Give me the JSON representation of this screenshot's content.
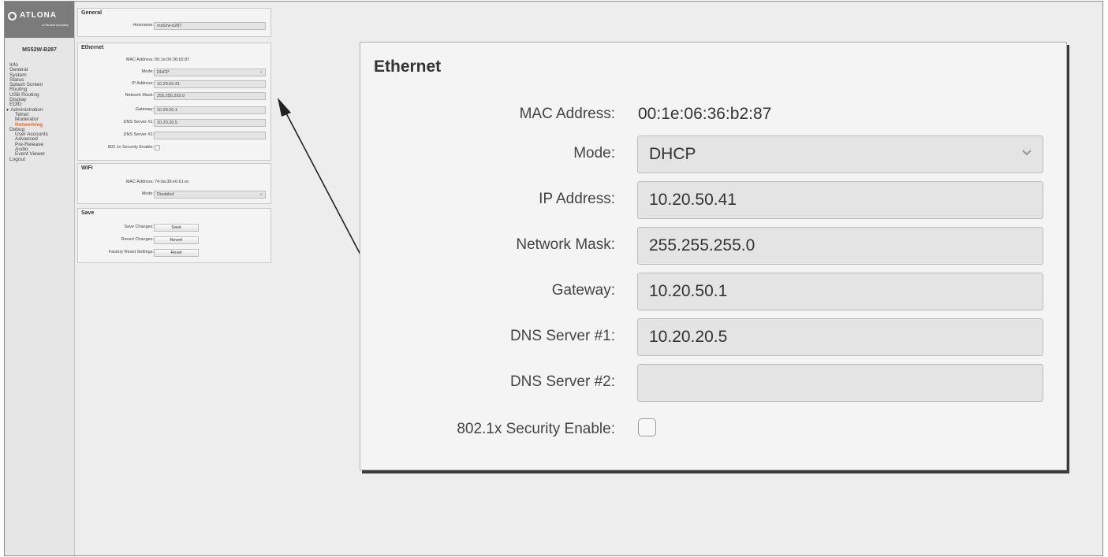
{
  "brand": {
    "logo": "ATLONA",
    "tagline": "a Panduit company"
  },
  "sidebar": {
    "device_name": "MS52W-B287",
    "items": [
      {
        "label": "Info",
        "level": 0
      },
      {
        "label": "General",
        "level": 0
      },
      {
        "label": "System",
        "level": 0
      },
      {
        "label": "Status",
        "level": 0
      },
      {
        "label": "Splash Screen",
        "level": 0
      },
      {
        "label": "Routing",
        "level": 0
      },
      {
        "label": "USB Routing",
        "level": 0
      },
      {
        "label": "Display",
        "level": 0
      },
      {
        "label": "EDID",
        "level": 0
      },
      {
        "label": "Administration",
        "level": 0,
        "expanded": true
      },
      {
        "label": "Telnet",
        "level": 1
      },
      {
        "label": "Moderator",
        "level": 1
      },
      {
        "label": "Networking",
        "level": 1,
        "active": true
      },
      {
        "label": "Debug",
        "level": 1
      },
      {
        "label": "User Accounts",
        "level": 1
      },
      {
        "label": "Advanced",
        "level": 1
      },
      {
        "label": "Pre-Release",
        "level": 1
      },
      {
        "label": "Audio",
        "level": 1
      },
      {
        "label": "Event Viewer",
        "level": 1
      },
      {
        "label": "Logout",
        "level": 0
      }
    ]
  },
  "general": {
    "title": "General",
    "hostname_label": "Hostname:",
    "hostname_value": "ms52w-b287"
  },
  "ethernet": {
    "title": "Ethernet",
    "mac_label": "MAC Address:",
    "mac_value": "00:1e:06:36:b2:87",
    "mode_label": "Mode:",
    "mode_value": "DHCP",
    "ip_label": "IP Address:",
    "ip_value": "10.20.50.41",
    "mask_label": "Network Mask:",
    "mask_value": "255.255.255.0",
    "gateway_label": "Gateway:",
    "gateway_value": "10.20.50.1",
    "dns1_label": "DNS Server #1:",
    "dns1_value": "10.20.20.5",
    "dns2_label": "DNS Server #2:",
    "dns2_value": "",
    "security_label": "802.1x Security Enable:",
    "security_checked": false
  },
  "wifi": {
    "title": "WiFi",
    "mac_label": "MAC Address:",
    "mac_value": "74:da:38:e6:61:ec",
    "mode_label": "Mode:",
    "mode_value": "Disabled"
  },
  "save": {
    "title": "Save",
    "save_label": "Save Changes:",
    "save_button": "Save",
    "revert_label": "Revert Changes:",
    "revert_button": "Revert",
    "reset_label": "Factory Reset Settings:",
    "reset_button": "Reset"
  },
  "colors": {
    "accent": "#f26b21",
    "logo_bg": "#7b7b7b",
    "page_bg": "#ededed"
  }
}
